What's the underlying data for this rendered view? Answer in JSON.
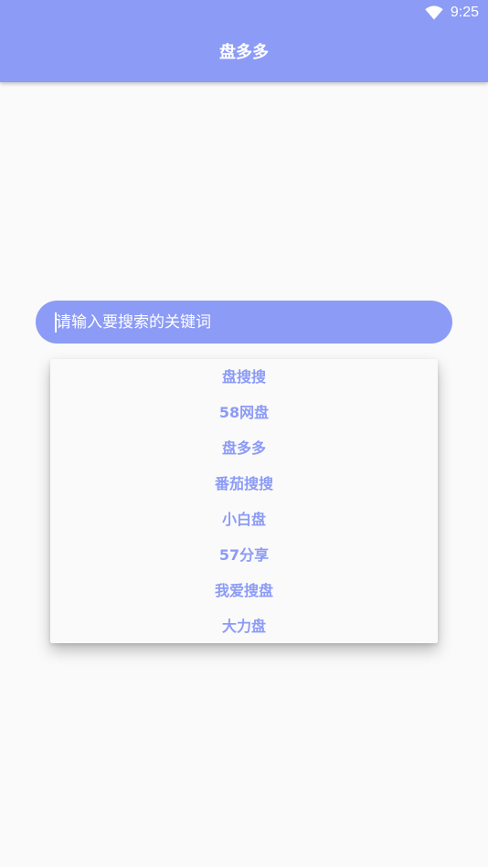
{
  "status_bar": {
    "time": "9:25",
    "wifi_icon": "wifi-icon"
  },
  "app_bar": {
    "title": "盘多多",
    "background_color": "#8c9bf6"
  },
  "search": {
    "placeholder": "请输入要搜索的关键词",
    "value": ""
  },
  "dropdown": {
    "items": [
      "盘搜搜",
      "58网盘",
      "盘多多",
      "番茄搜搜",
      "小白盘",
      "57分享",
      "我爱搜盘",
      "大力盘"
    ]
  },
  "colors": {
    "accent": "#8c9bf6",
    "background": "#fafafa"
  }
}
